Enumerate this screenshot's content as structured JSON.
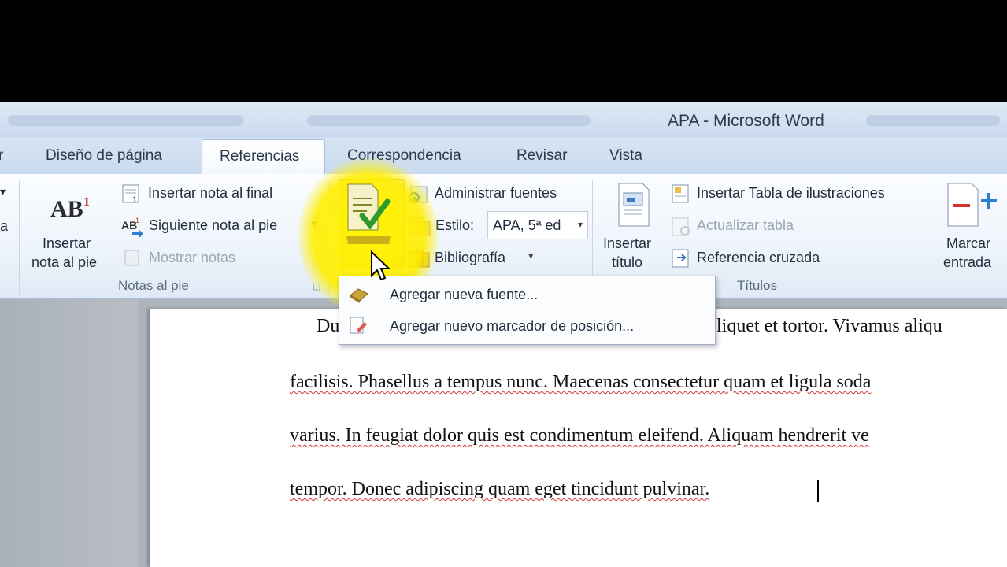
{
  "window": {
    "title": "APA  -  Microsoft Word"
  },
  "tabs": [
    {
      "label": "r"
    },
    {
      "label": "Diseño de página"
    },
    {
      "label": "Referencias"
    },
    {
      "label": "Correspondencia"
    },
    {
      "label": "Revisar"
    },
    {
      "label": "Vista"
    }
  ],
  "ribbon": {
    "left_partial": "a",
    "notas": {
      "insert_footnote_line1": "Insertar",
      "insert_footnote_line2": "nota al pie",
      "insert_endnote": "Insertar nota al final",
      "next_footnote": "Siguiente nota al pie",
      "show_notes": "Mostrar notas",
      "group_label": "Notas al pie"
    },
    "citas": {
      "manage_sources": "Administrar fuentes",
      "style_label": "Estilo:",
      "style_value": "APA, 5ª ed",
      "bibliography": "Bibliografía"
    },
    "titulos": {
      "insert_caption_line1": "Insertar",
      "insert_caption_line2": "título",
      "insert_table_figures": "Insertar Tabla de ilustraciones",
      "update_table": "Actualizar tabla",
      "cross_reference": "Referencia cruzada",
      "group_label": "Títulos"
    },
    "indice": {
      "mark_entry_line1": "Marcar",
      "mark_entry_line2": "entrada"
    }
  },
  "dropdown": {
    "items": [
      {
        "label": "Agregar nueva fuente..."
      },
      {
        "label": "Agregar nuevo marcador de posición..."
      }
    ]
  },
  "document": {
    "line1_start": "Du",
    "line1_end": "liquet et tortor. Vivamus aliqu",
    "line2": "facilisis. Phasellus a tempus nunc. Maecenas consectetur quam et ligula soda",
    "line3": "varius. In feugiat dolor quis est condimentum eleifend. Aliquam hendrerit ve",
    "line4": "tempor. Donec adipiscing quam eget tincidunt pulvinar."
  },
  "colors": {
    "highlight": "#fff200",
    "ribbon_bg": "#eef4fb",
    "accent": "#3d6fb3"
  }
}
